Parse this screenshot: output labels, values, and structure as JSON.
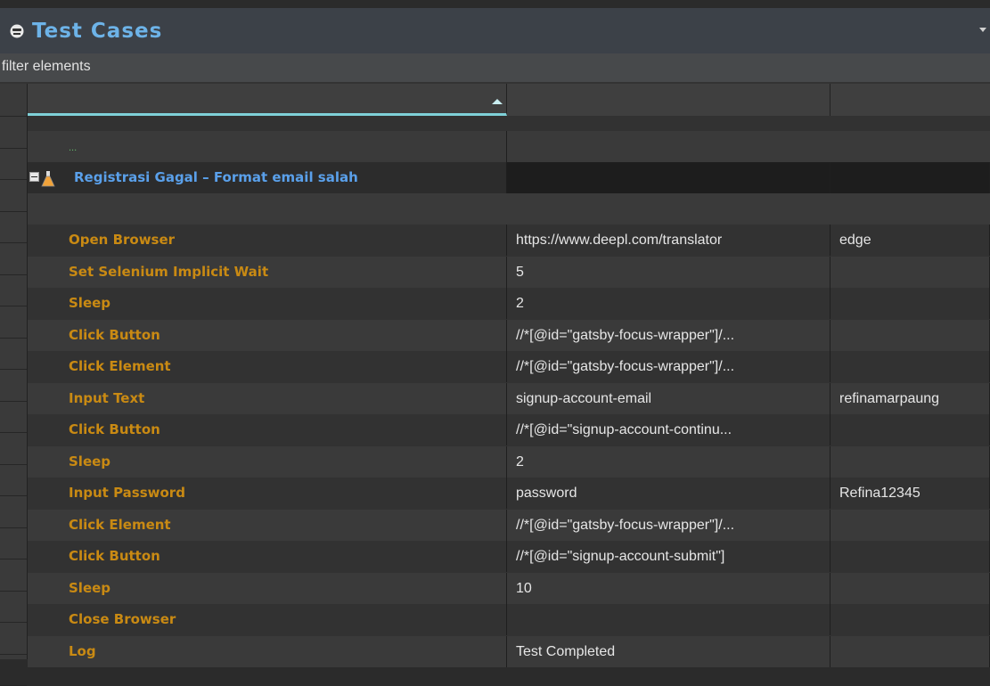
{
  "panel": {
    "title": "Test Cases"
  },
  "filter": {
    "placeholder": "filter elements"
  },
  "tree": {
    "ellipsis": "...",
    "test_case": "Registrasi Gagal – Format email salah",
    "steps": [
      {
        "keyword": "Open Browser",
        "arg1": "https://www.deepl.com/translator",
        "arg2": "edge"
      },
      {
        "keyword": "Set Selenium Implicit Wait",
        "arg1": "5",
        "arg2": ""
      },
      {
        "keyword": "Sleep",
        "arg1": "2",
        "arg2": ""
      },
      {
        "keyword": "Click Button",
        "arg1": "//*[@id=\"gatsby-focus-wrapper\"]/...",
        "arg2": ""
      },
      {
        "keyword": "Click Element",
        "arg1": "//*[@id=\"gatsby-focus-wrapper\"]/...",
        "arg2": ""
      },
      {
        "keyword": "Input Text",
        "arg1": "signup-account-email",
        "arg2": "refinamarpaung"
      },
      {
        "keyword": "Click Button",
        "arg1": "//*[@id=\"signup-account-continu...",
        "arg2": ""
      },
      {
        "keyword": "Sleep",
        "arg1": "2",
        "arg2": ""
      },
      {
        "keyword": "Input Password",
        "arg1": "password",
        "arg2": "Refina12345"
      },
      {
        "keyword": "Click Element",
        "arg1": "//*[@id=\"gatsby-focus-wrapper\"]/...",
        "arg2": ""
      },
      {
        "keyword": "Click Button",
        "arg1": "//*[@id=\"signup-account-submit\"]",
        "arg2": ""
      },
      {
        "keyword": "Sleep",
        "arg1": "10",
        "arg2": ""
      },
      {
        "keyword": "Close Browser",
        "arg1": "",
        "arg2": ""
      },
      {
        "keyword": "Log",
        "arg1": " Test Completed",
        "arg2": ""
      }
    ]
  },
  "colors": {
    "title": "#6db3e8",
    "keyword": "#c98a13",
    "test_case": "#5aa0ea",
    "sort_indicator": "#7fd1d8"
  }
}
